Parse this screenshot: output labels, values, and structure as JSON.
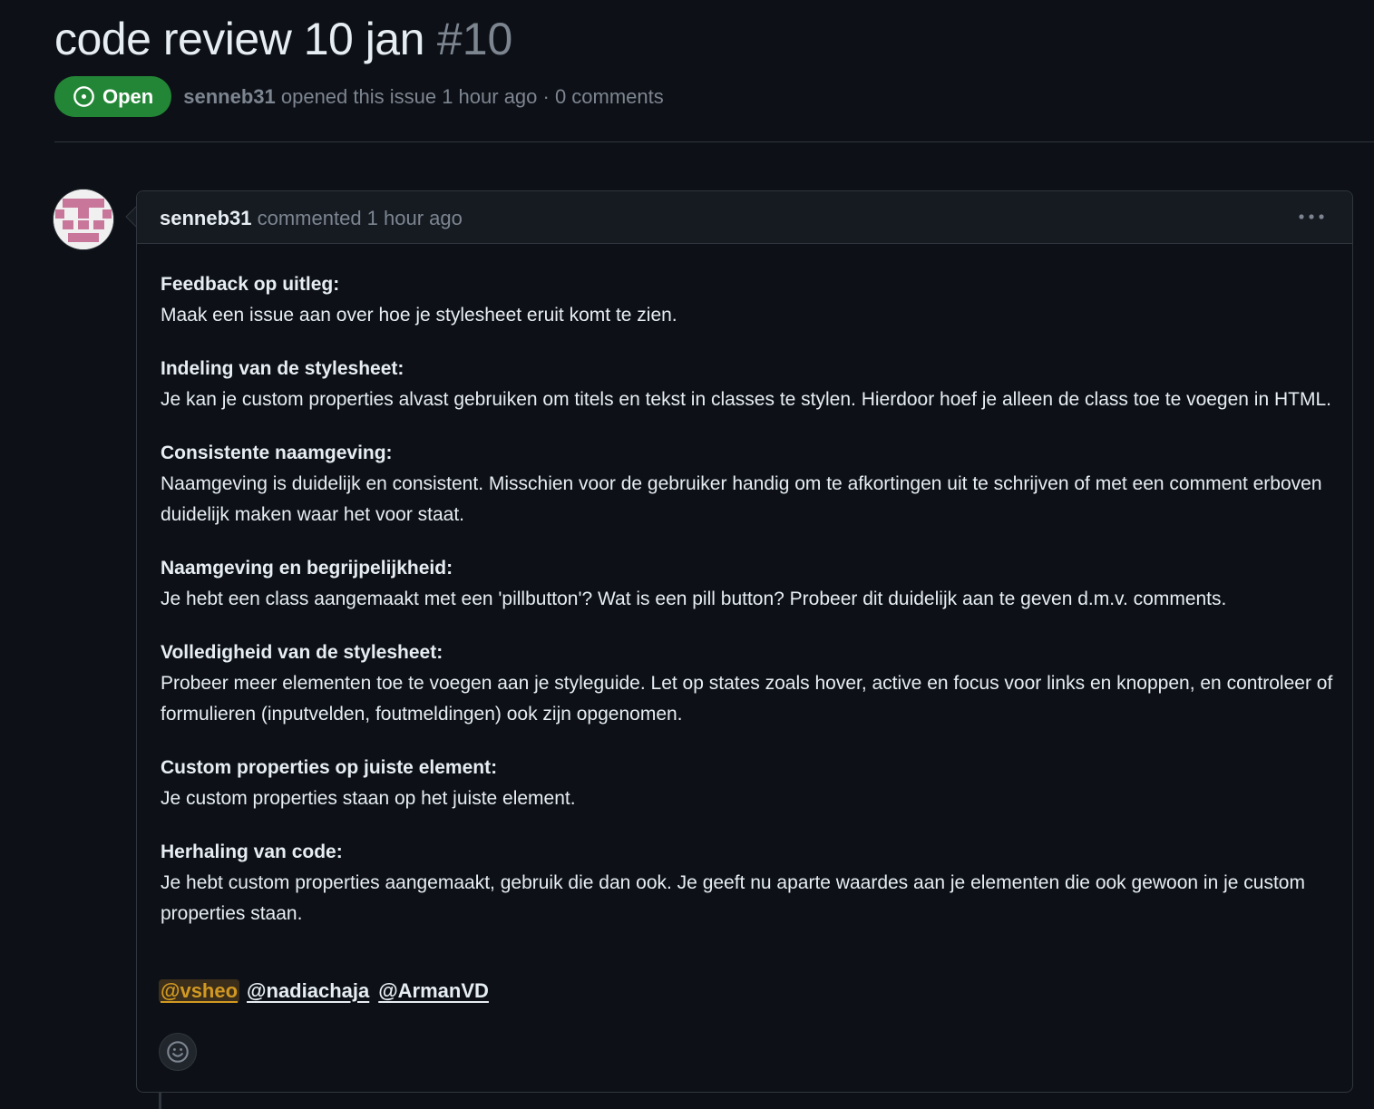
{
  "issue": {
    "title": "code review 10 jan",
    "number": "#10",
    "state": "Open",
    "author": "senneb31",
    "opened_text": "opened this issue 1 hour ago · 0 comments"
  },
  "comment": {
    "author": "senneb31",
    "meta": "commented 1 hour ago",
    "sections": [
      {
        "title": "Feedback op uitleg:",
        "text": "Maak een issue aan over hoe je stylesheet eruit komt te zien."
      },
      {
        "title": "Indeling van de stylesheet:",
        "text": "Je kan je custom properties alvast gebruiken om titels en tekst in classes te stylen. Hierdoor hoef je alleen de class toe te voegen in HTML."
      },
      {
        "title": "Consistente naamgeving:",
        "text": "Naamgeving is duidelijk en consistent. Misschien voor de gebruiker handig om te afkortingen uit te schrijven of met een comment erboven duidelijk maken waar het voor staat."
      },
      {
        "title": "Naamgeving en begrijpelijkheid:",
        "text": "Je hebt een class aangemaakt met een 'pillbutton'? Wat is een pill button? Probeer dit duidelijk aan te geven d.m.v. comments."
      },
      {
        "title": "Volledigheid van de stylesheet:",
        "text": "Probeer meer elementen toe te voegen aan je styleguide. Let op states zoals hover, active en focus voor links en knoppen, en controleer of formulieren (inputvelden, foutmeldingen) ook zijn opgenomen."
      },
      {
        "title": "Custom properties op juiste element:",
        "text": "Je custom properties staan op het juiste element."
      },
      {
        "title": "Herhaling van code:",
        "text": "Je hebt custom properties aangemaakt, gebruik die dan ook. Je geeft nu aparte waardes aan je elementen die ook gewoon in je custom properties staan."
      }
    ],
    "mentions": [
      "@vsheo",
      "@nadiachaja",
      "@ArmanVD"
    ]
  },
  "icons": {
    "state": "issue-opened-icon",
    "menu": "kebab-horizontal-icon",
    "reaction": "smiley-icon"
  },
  "colors": {
    "background": "#0d1117",
    "open_badge": "#238636",
    "muted_text": "#7d8590",
    "border": "#30363d",
    "self_mention": "#d29922"
  }
}
